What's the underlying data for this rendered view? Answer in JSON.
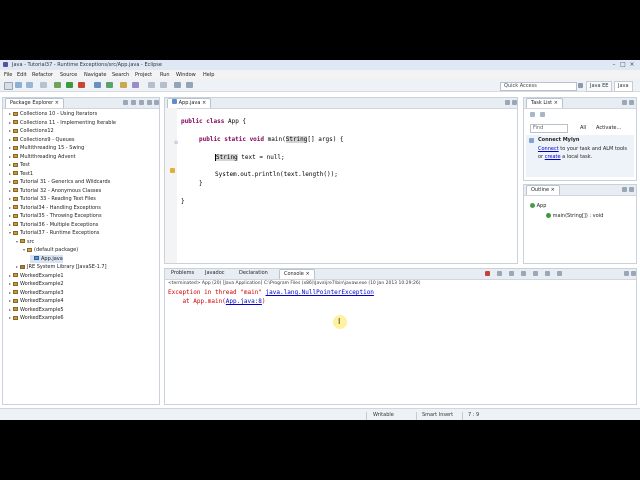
{
  "window": {
    "title": "Java - Tutorial37 - Runtime Exceptions/src/App.java - Eclipse"
  },
  "menu": [
    "File",
    "Edit",
    "Refactor",
    "Source",
    "Navigate",
    "Search",
    "Project",
    "Run",
    "Window",
    "Help"
  ],
  "toolbar": {
    "quick_access": "Quick Access",
    "perspectives": [
      "Java EE",
      "Java"
    ]
  },
  "package_explorer": {
    "tab": "Package Explorer",
    "items": [
      "Collections 10 - Using Iterators",
      "Collections 11 - Implementing Iterable",
      "Collections12",
      "Collections9 - Queues",
      "Multithreading 15 - Swing",
      "Multithreading Advent",
      "Test",
      "Test1",
      "Tutorial 31 - Generics and Wildcards",
      "Tutorial 32 - Anonymous Classes",
      "Tutorial 33 - Reading Text Files",
      "Tutorial34 - Handling Exceptions",
      "Tutorial35 - Throwing Exceptions",
      "Tutorial36 - Multiple Exceptions",
      "Tutorial37 - Runtime Exceptions",
      "src",
      "(default package)",
      "App.java",
      "JRE System Library [JavaSE-1.7]",
      "WorkedExample1",
      "WorkedExample2",
      "WorkedExample3",
      "WorkedExample4",
      "WorkedExample5",
      "WorkedExample6"
    ]
  },
  "editor": {
    "tab": "App.java",
    "lines": {
      "l1_kw": "public class",
      "l1_rest": " App {",
      "l2_kw": "public static void",
      "l2_a": " main(",
      "l2_hl": "String",
      "l2_b": "[] args) {",
      "l3_hl": "String",
      "l3_rest": " text = null;",
      "l4": "System.out.println(text.length());",
      "l5": "}",
      "l6": "}"
    }
  },
  "task_list": {
    "tab": "Task List",
    "find_placeholder": "Find",
    "all": "All",
    "activate": "Activate...",
    "connect_title": "Connect Mylyn",
    "connect_link": "Connect",
    "connect_text": " to your task and ALM tools",
    "connect_text2": "or ",
    "create_link": "create",
    "connect_text3": " a local task."
  },
  "outline": {
    "tab": "Outline",
    "class": "App",
    "method": "main(String[]) : void"
  },
  "bottom": {
    "tabs": [
      "Problems",
      "Javadoc",
      "Declaration",
      "Console"
    ],
    "terminated": "<terminated> App (20) [Java Application] C:\\Program Files (x86)\\Java\\jre7\\bin\\javaw.exe (10 Jan 2013 10:29:26)",
    "exc_prefix": "Exception in thread \"main\" ",
    "exc_link": "java.lang.NullPointerException",
    "at_prefix": "    at App.main(",
    "at_link": "App.java:8",
    "at_suffix": ")"
  },
  "status": {
    "writable": "Writable",
    "insert": "Smart Insert",
    "position": "7 : 9"
  },
  "colors": {
    "keyword": "#7f0055",
    "error": "#d00000",
    "link": "#0000cc"
  }
}
